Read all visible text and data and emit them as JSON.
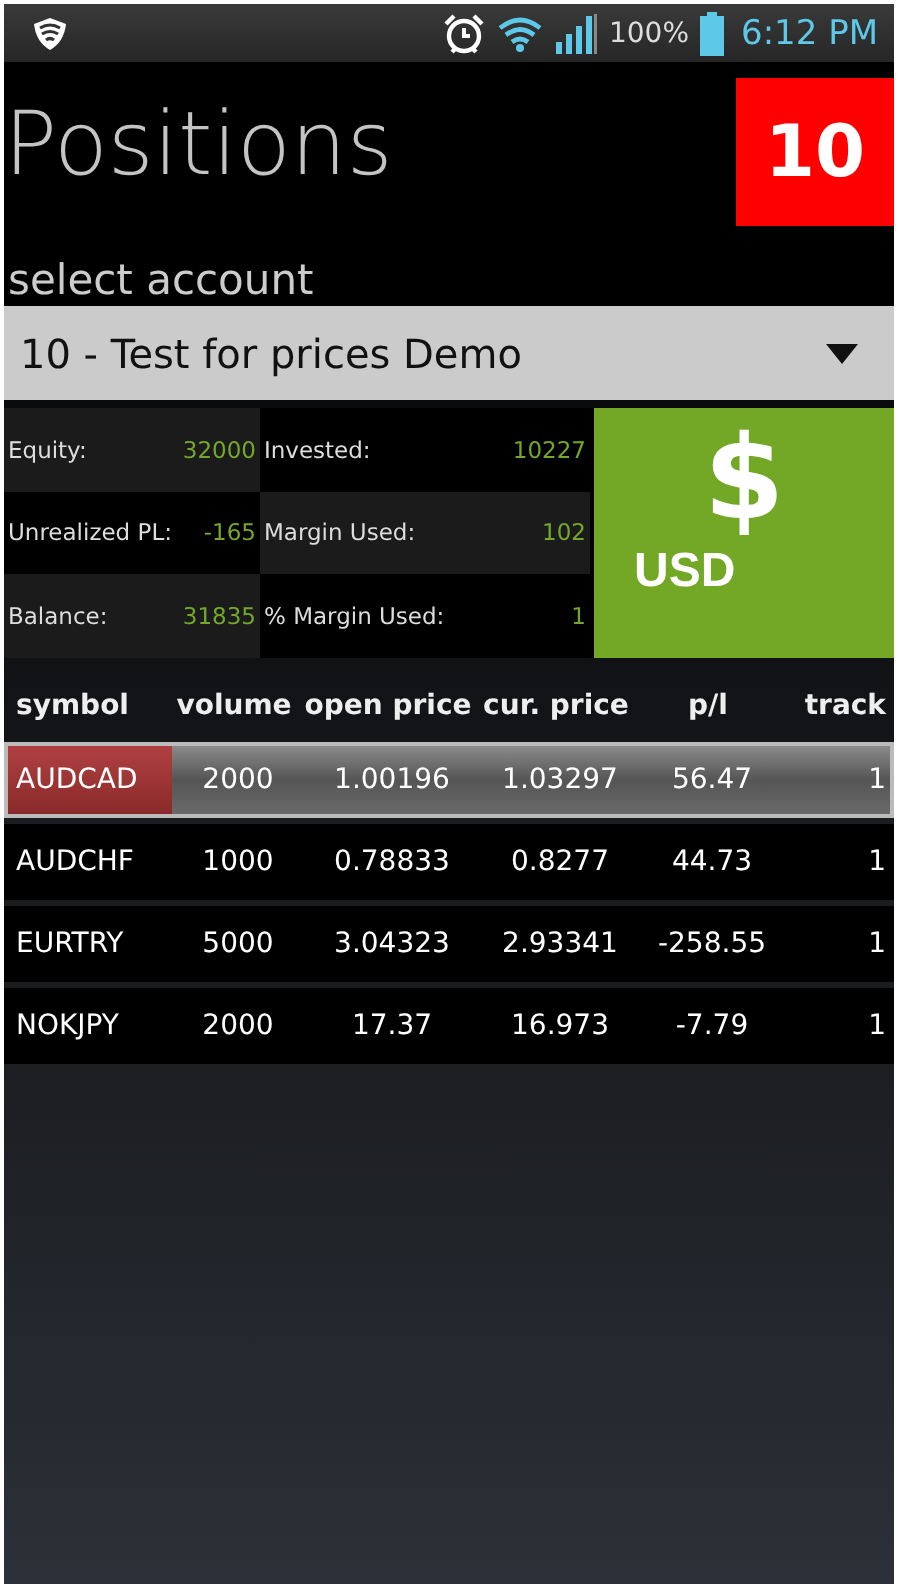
{
  "status_bar": {
    "battery_text": "100%",
    "time": "6:12 PM"
  },
  "header": {
    "title": "Positions",
    "badge": "10"
  },
  "account": {
    "label": "select account",
    "value": "10 - Test for prices Demo"
  },
  "summary": {
    "items": [
      {
        "label": "Equity:",
        "value": "32000"
      },
      {
        "label": "Invested:",
        "value": "10227"
      },
      {
        "label": "Unrealized PL:",
        "value": "-165"
      },
      {
        "label": "Margin Used:",
        "value": "102"
      },
      {
        "label": "Balance:",
        "value": "31835"
      },
      {
        "label": "% Margin Used:",
        "value": "1"
      }
    ],
    "currency_symbol": "$",
    "currency": "USD"
  },
  "table": {
    "columns": [
      "symbol",
      "volume",
      "open price",
      "cur. price",
      "p/l",
      "track"
    ],
    "rows": [
      {
        "cells": [
          "AUDCAD",
          "2000",
          "1.00196",
          "1.03297",
          "56.47",
          "1"
        ],
        "selected": true
      },
      {
        "cells": [
          "AUDCHF",
          "1000",
          "0.78833",
          "0.8277",
          "44.73",
          "1"
        ],
        "selected": false
      },
      {
        "cells": [
          "EURTRY",
          "5000",
          "3.04323",
          "2.93341",
          "-258.55",
          "1"
        ],
        "selected": false
      },
      {
        "cells": [
          "NOKJPY",
          "2000",
          "17.37",
          "16.973",
          "-7.79",
          "1"
        ],
        "selected": false
      }
    ]
  }
}
